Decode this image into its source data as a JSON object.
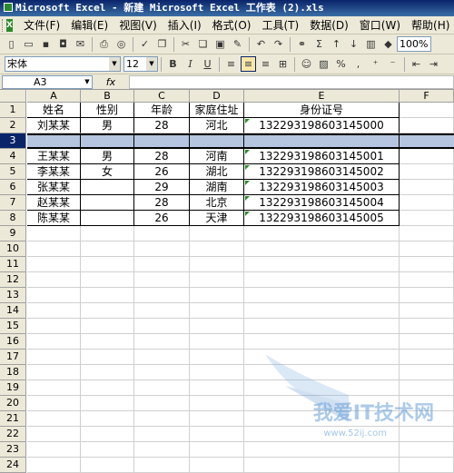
{
  "window": {
    "title": "Microsoft Excel - 新建 Microsoft Excel 工作表 (2).xls"
  },
  "menu": [
    "文件(F)",
    "编辑(E)",
    "视图(V)",
    "插入(I)",
    "格式(O)",
    "工具(T)",
    "数据(D)",
    "窗口(W)",
    "帮助(H)"
  ],
  "toolbar": {
    "zoom": "100%",
    "sigma": "Σ"
  },
  "format": {
    "font": "宋体",
    "size": "12",
    "bold": "B",
    "italic": "I",
    "underline": "U",
    "percent": "%"
  },
  "formula_bar": {
    "name_box": "A3",
    "fx": "fx",
    "content": ""
  },
  "columns": [
    "A",
    "B",
    "C",
    "D",
    "E",
    "F"
  ],
  "rows": [
    "1",
    "2",
    "3",
    "4",
    "5",
    "6",
    "7",
    "8",
    "9",
    "10",
    "11",
    "12",
    "13",
    "14",
    "15",
    "16",
    "17",
    "18",
    "19",
    "20",
    "21",
    "22",
    "23",
    "24"
  ],
  "selected_row": "3",
  "table": {
    "headers": [
      "姓名",
      "性别",
      "年龄",
      "家庭住址",
      "身份证号"
    ],
    "rows": [
      [
        "刘某某",
        "男",
        "28",
        "河北",
        "132293198603145000"
      ],
      [
        "",
        "",
        "",
        "",
        ""
      ],
      [
        "王某某",
        "男",
        "28",
        "河南",
        "132293198603145001"
      ],
      [
        "李某某",
        "女",
        "26",
        "湖北",
        "132293198603145002"
      ],
      [
        "张某某",
        "",
        "29",
        "湖南",
        "132293198603145003"
      ],
      [
        "赵某某",
        "",
        "28",
        "北京",
        "132293198603145004"
      ],
      [
        "陈某某",
        "",
        "26",
        "天津",
        "132293198603145005"
      ]
    ]
  },
  "watermark": {
    "text": "我爱IT技术网",
    "site": "www.52ij.com"
  },
  "colors": {
    "title_bar": "#0a246a",
    "selection": "#b5c4df",
    "toolbar_bg": "#ece9d8"
  }
}
